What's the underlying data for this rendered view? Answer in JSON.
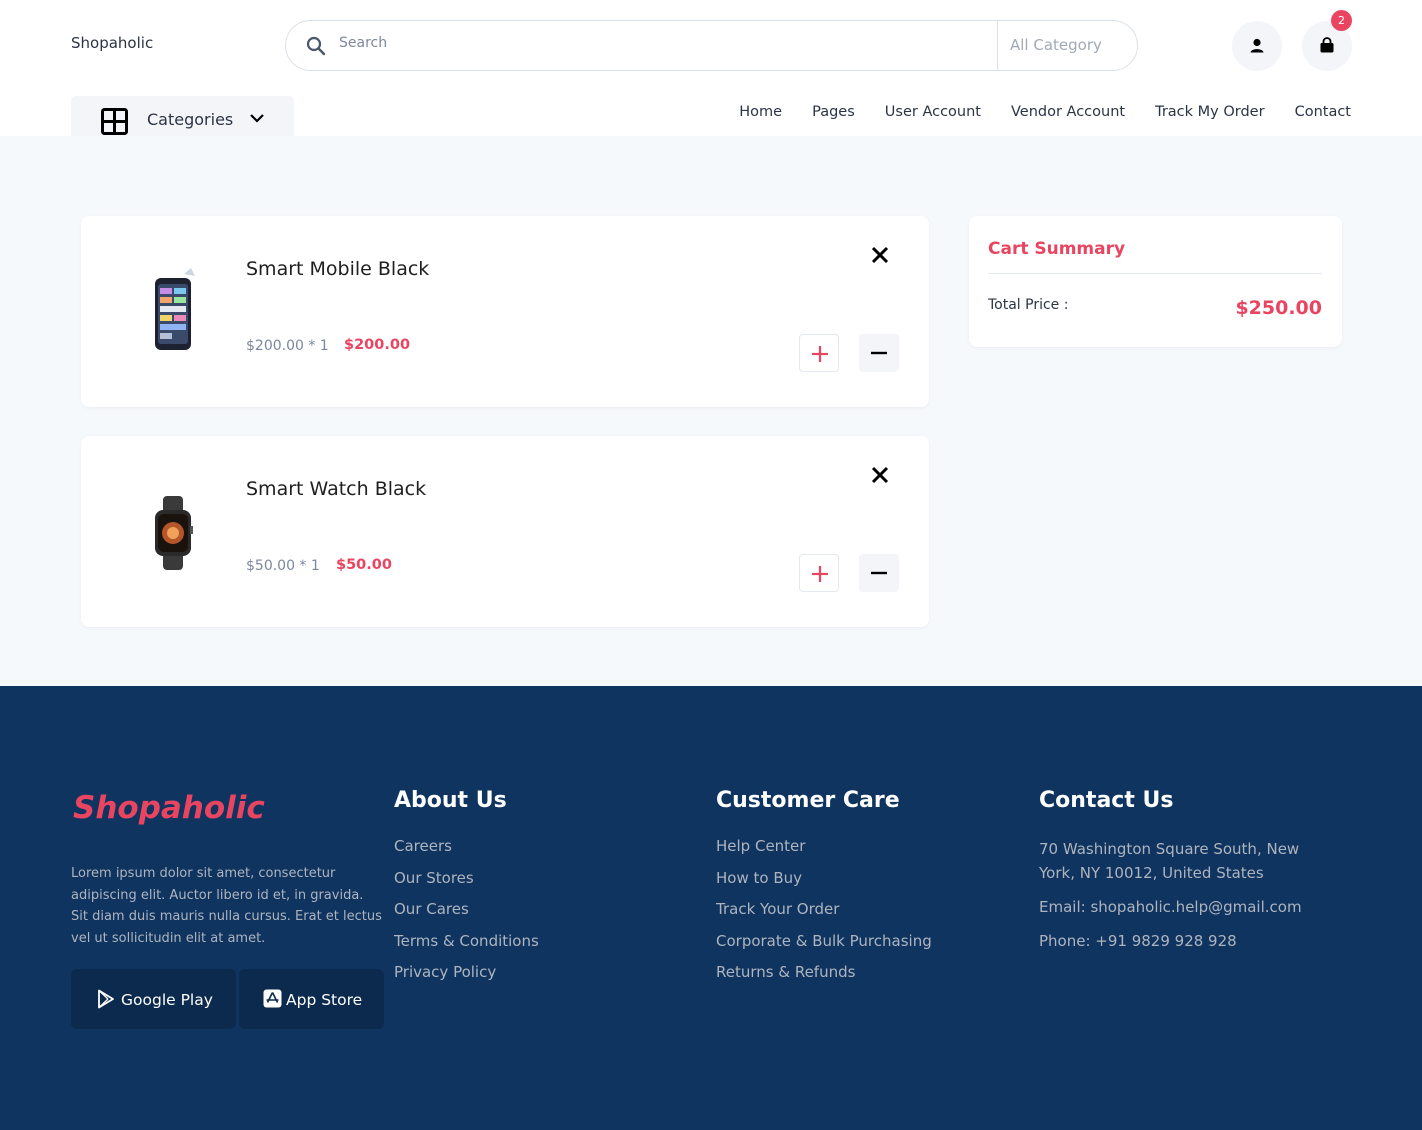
{
  "header": {
    "brand": "Shopaholic",
    "search_placeholder": "Search",
    "category_select": "All Category",
    "cart_count": "2",
    "categories_label": "Categories",
    "nav": [
      "Home",
      "Pages",
      "User Account",
      "Vendor Account",
      "Track My Order",
      "Contact"
    ]
  },
  "cart": {
    "items": [
      {
        "name": "Smart Mobile Black",
        "unit_line": "$200.00 * 1",
        "total": "$200.00",
        "image": "smartphone-icon"
      },
      {
        "name": "Smart Watch Black",
        "unit_line": "$50.00 * 1",
        "total": "$50.00",
        "image": "smartwatch-icon"
      }
    ],
    "summary": {
      "title": "Cart Summary",
      "total_label": "Total Price :",
      "total_value": "$250.00"
    }
  },
  "footer": {
    "logo": "Shopaholic",
    "description": "Lorem ipsum dolor sit amet, consectetur adipiscing elit. Auctor libero id et, in gravida. Sit diam duis mauris nulla cursus. Erat et lectus vel ut sollicitudin elit at amet.",
    "google_play": "Google Play",
    "app_store": "App Store",
    "about": {
      "title": "About Us",
      "links": [
        "Careers",
        "Our Stores",
        "Our Cares",
        "Terms & Conditions",
        "Privacy Policy"
      ]
    },
    "care": {
      "title": "Customer Care",
      "links": [
        "Help Center",
        "How to Buy",
        "Track Your Order",
        "Corporate & Bulk Purchasing",
        "Returns & Refunds"
      ]
    },
    "contact": {
      "title": "Contact Us",
      "address": "70 Washington Square South, New York, NY 10012, United States",
      "email": "Email: shopaholic.help@gmail.com",
      "phone": "Phone: +91 9829 928 928"
    }
  },
  "colors": {
    "accent": "#e94560",
    "footer_bg": "#0f3460",
    "page_bg": "#f6f9fc"
  }
}
